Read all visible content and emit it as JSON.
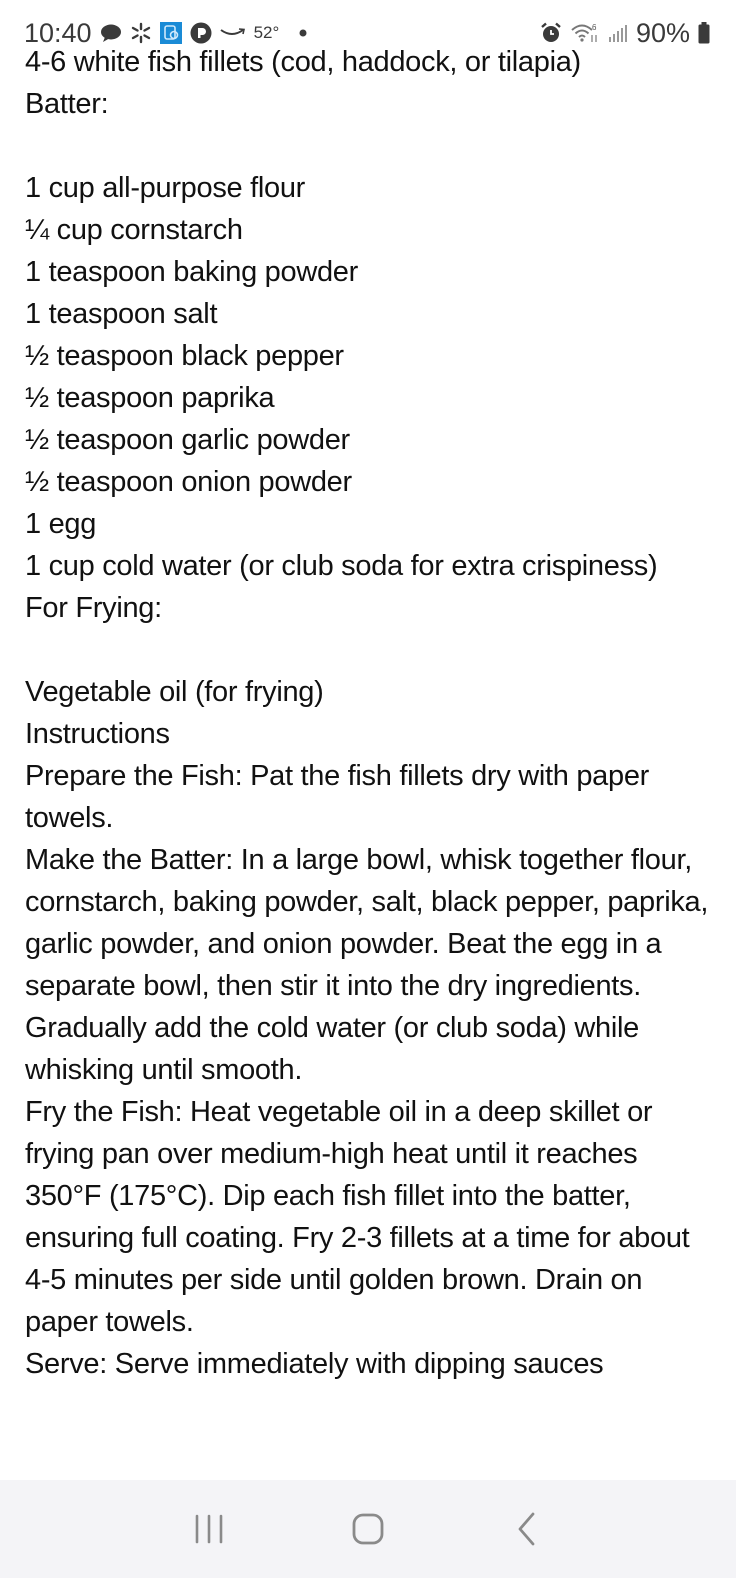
{
  "status_bar": {
    "time": "10:40",
    "temperature": "52°",
    "battery": "90%",
    "notification_icons": [
      "chat-bubble-icon",
      "sparkle-icon",
      "app-blue-icon",
      "pandora-icon",
      "amazon-icon",
      "dot-icon"
    ],
    "system_icons": [
      "alarm-icon",
      "wifi-6-icon",
      "signal-icon",
      "battery-icon"
    ]
  },
  "recipe": {
    "lines": [
      "4-6 white fish fillets (cod, haddock, or tilapia)",
      "Batter:",
      "",
      "1 cup all-purpose flour",
      "¼ cup cornstarch",
      "1 teaspoon baking powder",
      "1 teaspoon salt",
      "½ teaspoon black pepper",
      "½ teaspoon paprika",
      "½ teaspoon garlic powder",
      "½ teaspoon onion powder",
      "1 egg",
      "1 cup cold water (or club soda for extra crispiness)",
      "For Frying:",
      "",
      "Vegetable oil (for frying)",
      "Instructions",
      "Prepare the Fish: Pat the fish fillets dry with paper towels.",
      "Make the Batter: In a large bowl, whisk together flour, cornstarch, baking powder, salt, black pepper, paprika, garlic powder, and onion powder. Beat the egg in a separate bowl, then stir it into the dry ingredients. Gradually add the cold water (or club soda) while whisking until smooth.",
      "Fry the Fish: Heat vegetable oil in a deep skillet or frying pan over medium-high heat until it reaches 350°F (175°C). Dip each fish fillet into the batter, ensuring full coating. Fry 2-3 fillets at a time for about 4-5 minutes per side until golden brown. Drain on paper towels.",
      "Serve: Serve immediately with dipping sauces"
    ]
  },
  "nav_bar": {
    "recents_label": "Recent apps",
    "home_label": "Home",
    "back_label": "Back"
  }
}
